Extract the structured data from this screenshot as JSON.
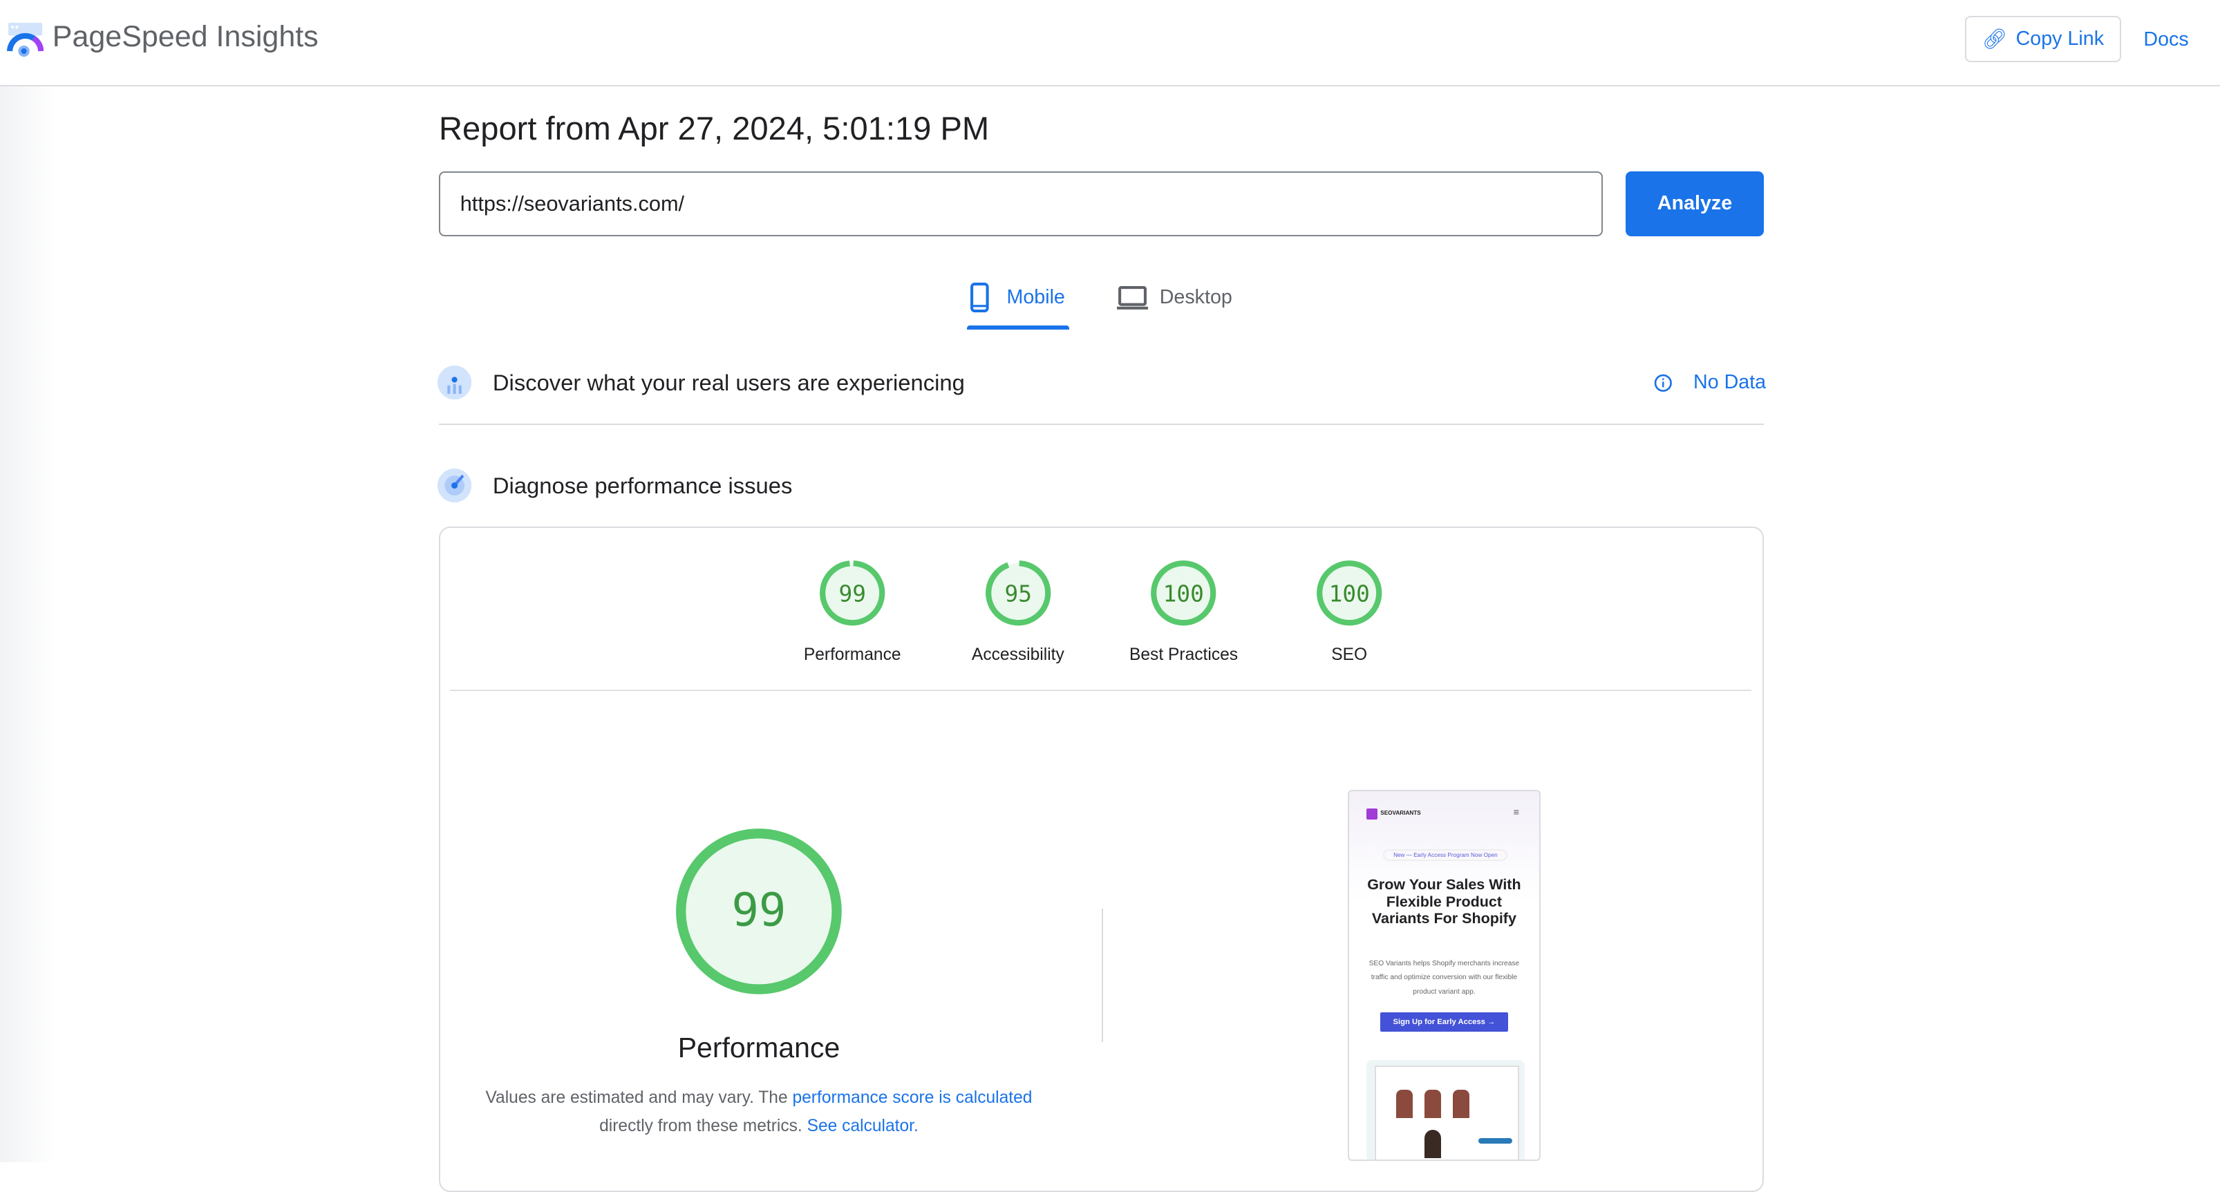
{
  "header": {
    "brand": "PageSpeed Insights",
    "copy_link": "Copy Link",
    "docs": "Docs"
  },
  "report": {
    "title": "Report from Apr 27, 2024, 5:01:19 PM",
    "url": "https://seovariants.com/",
    "analyze": "Analyze"
  },
  "tabs": [
    {
      "label": "Mobile",
      "active": true
    },
    {
      "label": "Desktop",
      "active": false
    }
  ],
  "field": {
    "title": "Discover what your real users are experiencing",
    "status": "No Data"
  },
  "lab": {
    "title": "Diagnose performance issues"
  },
  "scores": [
    {
      "label": "Performance",
      "value": 99
    },
    {
      "label": "Accessibility",
      "value": 95
    },
    {
      "label": "Best Practices",
      "value": 100
    },
    {
      "label": "SEO",
      "value": 100
    }
  ],
  "performance": {
    "value": "99",
    "label": "Performance",
    "desc1": "Values are estimated and may vary. The ",
    "link1": "performance score is calculated",
    "desc2": "directly from these metrics. ",
    "link2": "See calculator."
  },
  "screenshot": {
    "brand": "SEOVARIANTS",
    "badge": "New — Early Access Program Now Open",
    "headline": "Grow Your Sales With Flexible Product Variants For Shopify",
    "body": "SEO Variants helps Shopify merchants increase traffic and optimize conversion with our flexible product variant app.",
    "cta": "Sign Up for Early Access →"
  },
  "colors": {
    "accent": "#1a73e8",
    "pass": "#0cce6b",
    "pass_text": "#008800"
  }
}
